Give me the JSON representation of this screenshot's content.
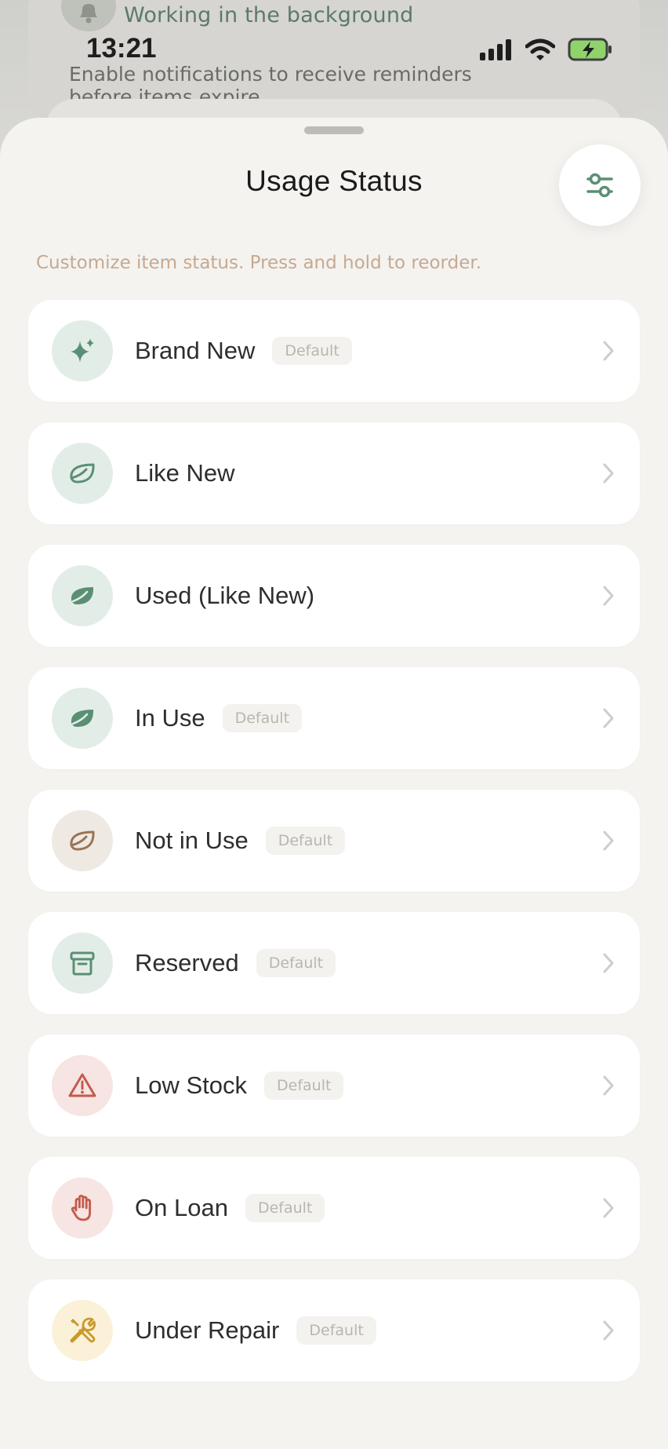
{
  "notification": {
    "title": "Working in the background",
    "body": "Enable notifications to receive reminders before items expire"
  },
  "status_bar": {
    "time": "13:21"
  },
  "sheet": {
    "title": "Usage Status",
    "subtitle": "Customize item status. Press and hold to reorder."
  },
  "colors": {
    "sage": "#5b8f74",
    "sage_bg": "#e3ede8",
    "brown": "#9a7453",
    "brown_bg": "#efe9e4",
    "red": "#c45a4d",
    "red_bg": "#f6e5e2",
    "amber": "#c99a2e",
    "amber_bg": "#fbf1d8"
  },
  "items": [
    {
      "label": "Brand New",
      "badge": "Default",
      "icon": "sparkle-icon"
    },
    {
      "label": "Like New",
      "badge": "",
      "icon": "leaf-outline-icon"
    },
    {
      "label": "Used (Like New)",
      "badge": "",
      "icon": "leaf-filled-icon"
    },
    {
      "label": "In Use",
      "badge": "Default",
      "icon": "leaf-filled-icon"
    },
    {
      "label": "Not in Use",
      "badge": "Default",
      "icon": "leaf-outline-icon"
    },
    {
      "label": "Reserved",
      "badge": "Default",
      "icon": "archive-box-icon"
    },
    {
      "label": "Low Stock",
      "badge": "Default",
      "icon": "warning-triangle-icon"
    },
    {
      "label": "On Loan",
      "badge": "Default",
      "icon": "hand-icon"
    },
    {
      "label": "Under Repair",
      "badge": "Default",
      "icon": "tools-icon"
    }
  ]
}
